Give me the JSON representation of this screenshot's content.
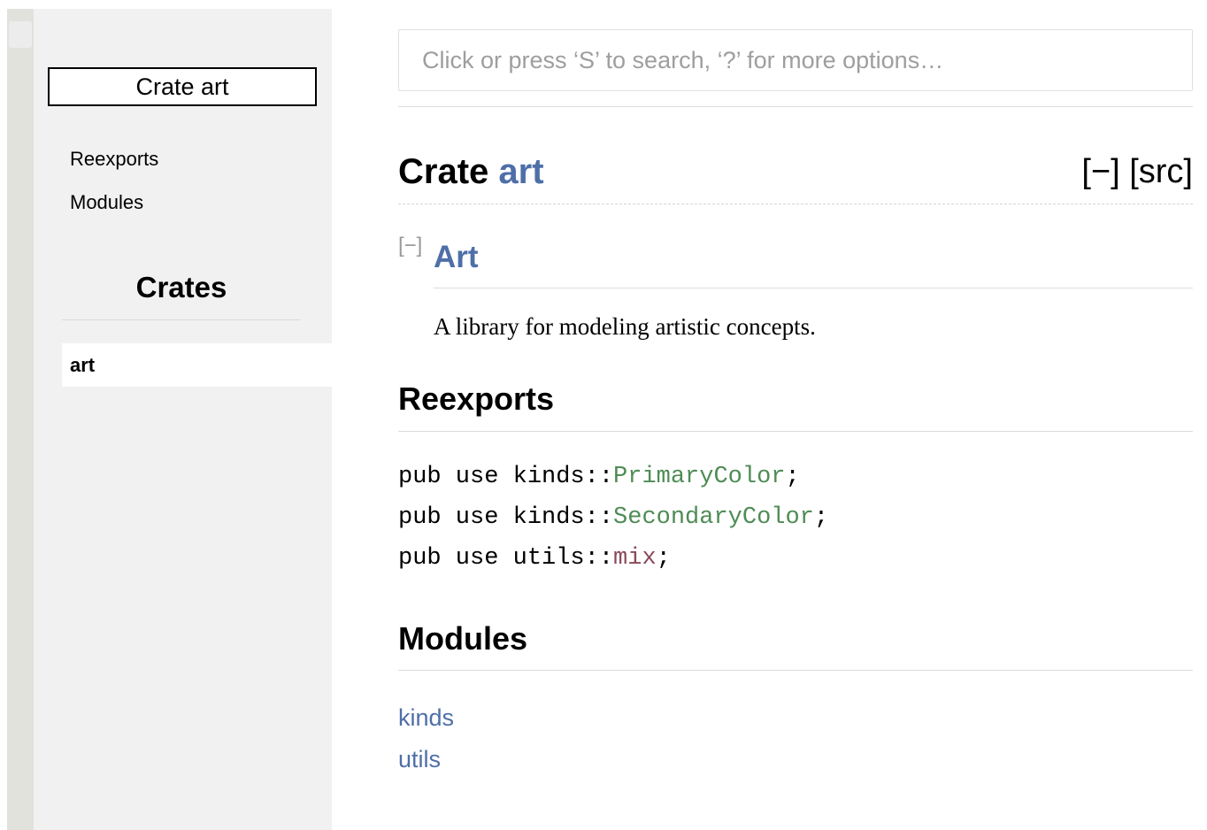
{
  "sidebar": {
    "crate_title": "Crate art",
    "items": [
      {
        "label": "Reexports"
      },
      {
        "label": "Modules"
      }
    ],
    "crates_heading": "Crates",
    "crates": [
      {
        "label": "art"
      }
    ]
  },
  "search": {
    "placeholder": "Click or press ‘S’ to search, ‘?’ for more options…"
  },
  "header": {
    "prefix": "Crate ",
    "crate_name": "art",
    "collapse_label": "[−]",
    "src_label": "[src]"
  },
  "docblock": {
    "toggle_label": "[−]",
    "heading": "Art",
    "description": "A library for modeling artistic concepts."
  },
  "reexports": {
    "heading": "Reexports",
    "lines": [
      {
        "prefix": "pub use kinds::",
        "name": "PrimaryColor",
        "suffix": ";"
      },
      {
        "prefix": "pub use kinds::",
        "name": "SecondaryColor",
        "suffix": ";"
      },
      {
        "prefix": "pub use utils::",
        "name": "mix",
        "suffix": ";"
      }
    ]
  },
  "modules": {
    "heading": "Modules",
    "items": [
      {
        "label": "kinds"
      },
      {
        "label": "utils"
      }
    ]
  },
  "colors": {
    "link": "#4e6fa8",
    "type": "#4e8c55",
    "function": "#8a4a5a",
    "sidebar_bg": "#f1f1f1"
  }
}
